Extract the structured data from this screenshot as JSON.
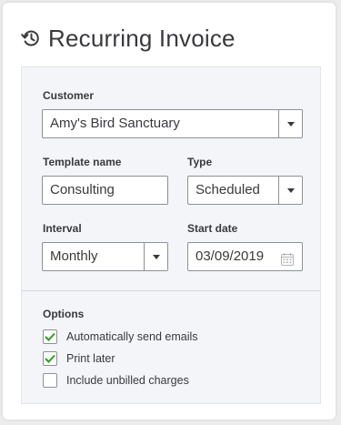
{
  "dialog": {
    "title": "Recurring Invoice",
    "header_icon": "history-clock-icon"
  },
  "form": {
    "customer": {
      "label": "Customer",
      "value": "Amy's Bird Sanctuary"
    },
    "template_name": {
      "label": "Template name",
      "value": "Consulting"
    },
    "type": {
      "label": "Type",
      "value": "Scheduled"
    },
    "interval": {
      "label": "Interval",
      "value": "Monthly"
    },
    "start_date": {
      "label": "Start date",
      "value": "03/09/2019",
      "icon": "calendar-icon"
    }
  },
  "options": {
    "label": "Options",
    "items": [
      {
        "label": "Automatically send emails",
        "checked": true
      },
      {
        "label": "Print later",
        "checked": true
      },
      {
        "label": "Include unbilled charges",
        "checked": false
      }
    ]
  },
  "colors": {
    "check": "#2ca01c",
    "panel_bg": "#f4f5f8",
    "text": "#393a3d"
  }
}
